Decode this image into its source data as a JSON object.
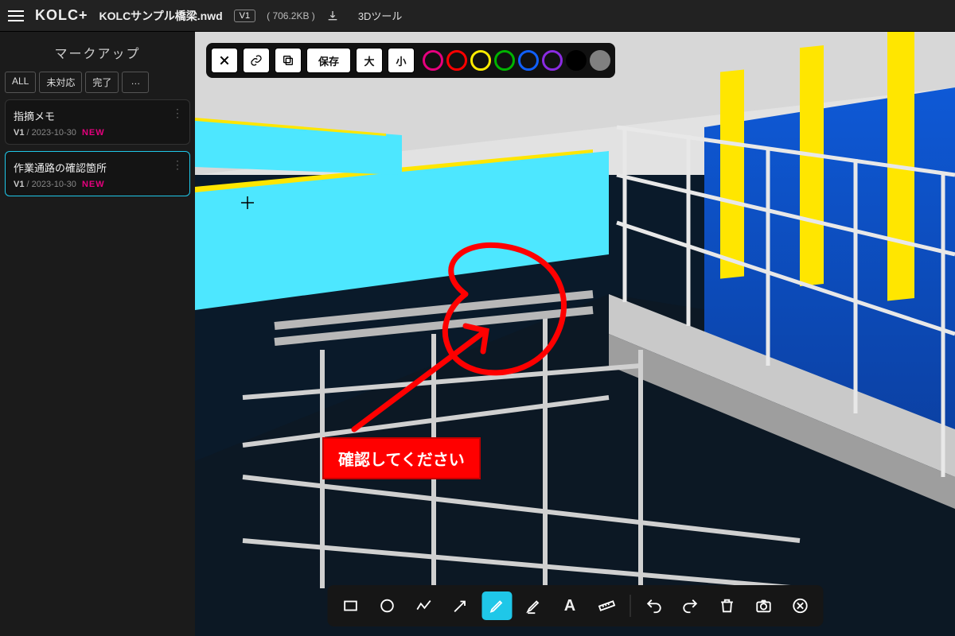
{
  "header": {
    "logo": "KOLC+",
    "filename": "KOLCサンプル橋梁.nwd",
    "version": "V1",
    "size": "( 706.2KB )",
    "tool_label": "3Dツール"
  },
  "sidebar": {
    "title": "マークアップ",
    "filters": {
      "all": "ALL",
      "pending": "未対応",
      "done": "完了",
      "more": "…"
    },
    "cards": [
      {
        "title": "指摘メモ",
        "version": "V1",
        "date": "2023-10-30",
        "badge": "NEW",
        "selected": false
      },
      {
        "title": "作業通路の確認箇所",
        "version": "V1",
        "date": "2023-10-30",
        "badge": "NEW",
        "selected": true
      }
    ]
  },
  "top_tools": {
    "save": "保存",
    "big": "大",
    "small": "小",
    "swatches": [
      "#e6007e",
      "#ff0000",
      "#ffeb00",
      "#00b400",
      "#1060ff",
      "#8a2be2",
      "#000000",
      "#808080"
    ]
  },
  "annotation": {
    "label": "確認してください"
  },
  "bottom_tools": {
    "rect": "rect",
    "circle": "circle",
    "polyline": "polyline",
    "arrow": "arrow",
    "pen": "pen",
    "highlight": "highlight",
    "text": "A",
    "ruler": "ruler",
    "undo": "undo",
    "redo": "redo",
    "trash": "trash",
    "camera": "camera",
    "close": "close"
  }
}
